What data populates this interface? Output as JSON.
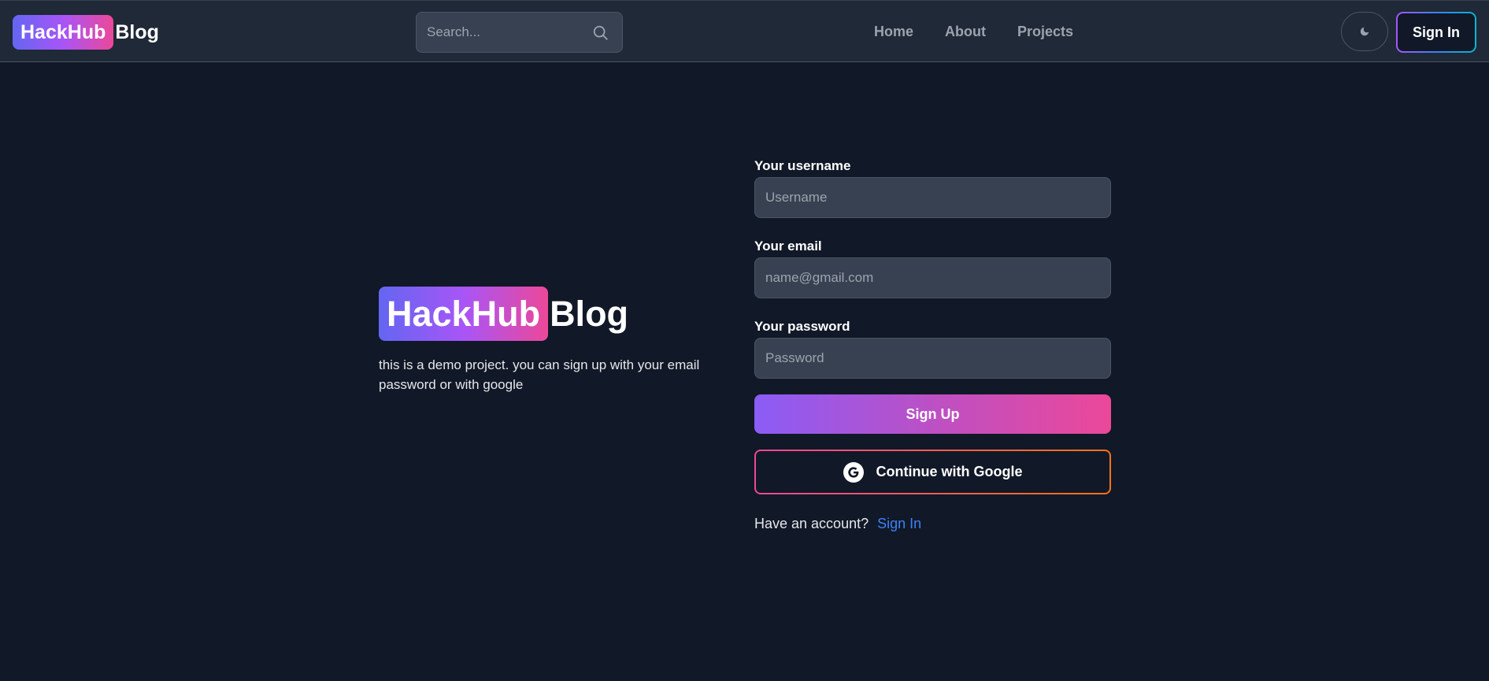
{
  "header": {
    "logo_badge": "HackHub",
    "logo_rest": "Blog",
    "search_placeholder": "Search...",
    "nav": [
      "Home",
      "About",
      "Projects"
    ],
    "signin_label": "Sign In"
  },
  "hero": {
    "logo_badge": "HackHub",
    "logo_rest": "Blog",
    "description": "this is a demo project. you can sign up with your email password or with google"
  },
  "form": {
    "username_label": "Your username",
    "username_placeholder": "Username",
    "email_label": "Your email",
    "email_placeholder": "name@gmail.com",
    "password_label": "Your password",
    "password_placeholder": "Password",
    "signup_label": "Sign Up",
    "google_label": "Continue with Google",
    "account_text": "Have an account?",
    "signin_link": "Sign In"
  },
  "icons": {
    "search": "search-icon",
    "theme": "moon-icon",
    "google": "google-icon"
  },
  "colors": {
    "background": "#111827",
    "navbar": "#1f2937",
    "input": "#374151",
    "link": "#3b82f6",
    "gradient_start": "#6366f1",
    "gradient_mid": "#a855f7",
    "gradient_end": "#ec4899"
  }
}
